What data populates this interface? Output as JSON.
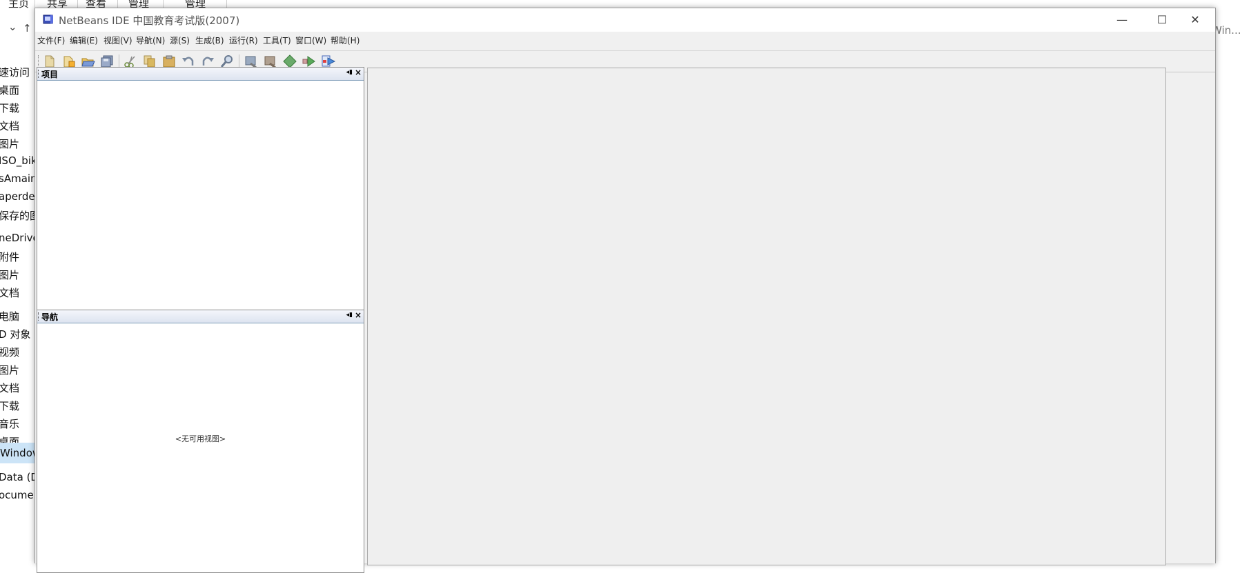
{
  "explorer": {
    "ribbon_tabs": [
      "主页",
      "共享",
      "查看",
      "管理",
      "管理"
    ],
    "nav": {
      "expand": "⌄",
      "up": "↑"
    },
    "search_placeholder": "Win...",
    "sidebar_items": [
      "速访问",
      "桌面",
      "下载",
      "文档",
      "图片",
      "ISO_bik",
      "sAmain",
      "aperde",
      "保存的图",
      "neDrive",
      "附件",
      "图片",
      "文档",
      "电脑",
      "D 对象",
      "视频",
      "图片",
      "文档",
      "下载",
      "音乐",
      "桌面",
      "Window",
      "Data (D:)",
      "ocume"
    ]
  },
  "netbeans": {
    "title": "NetBeans IDE 中国教育考试版(2007)",
    "window_controls": {
      "minimize": "—",
      "maximize": "☐",
      "close": "✕"
    },
    "menu": [
      "文件(F)",
      "编辑(E)",
      "视图(V)",
      "导航(N)",
      "源(S)",
      "生成(B)",
      "运行(R)",
      "工具(T)",
      "窗口(W)",
      "帮助(H)"
    ],
    "toolbar": {
      "icons": [
        "new-project-icon",
        "new-file-icon",
        "open-project-icon",
        "save-all-icon",
        "cut-icon",
        "copy-icon",
        "paste-icon",
        "undo-icon",
        "redo-icon",
        "find-icon",
        "build-icon",
        "clean-build-icon",
        "run-icon",
        "debug-icon",
        "run-file-icon"
      ]
    },
    "projects_panel": {
      "title": "项目",
      "minimize": "◂▮",
      "close": "×"
    },
    "navigator_panel": {
      "title": "导航",
      "minimize": "◂▮",
      "close": "×",
      "empty_text": "<无可用视图>"
    }
  },
  "colors": {
    "panel_header_border": "#7f9db9",
    "editor_bg": "#efefef",
    "title_text": "#555555"
  }
}
